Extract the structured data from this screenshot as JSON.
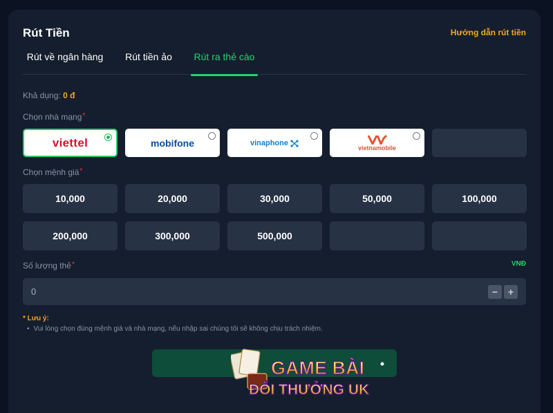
{
  "header": {
    "title": "Rút Tiền",
    "guide_link": "Hướng dẫn rút tiền"
  },
  "tabs": [
    {
      "label": "Rút về ngân hàng",
      "active": false
    },
    {
      "label": "Rút tiền ảo",
      "active": false
    },
    {
      "label": "Rút ra thẻ cào",
      "active": true
    }
  ],
  "balance": {
    "label": "Khả dụng:",
    "amount": "0 đ"
  },
  "carrier_section": {
    "label": "Chọn nhà mạng",
    "required_mark": "*",
    "carriers": [
      {
        "name": "viettel",
        "selected": true
      },
      {
        "name": "mobifone",
        "selected": false
      },
      {
        "name": "vinaphone",
        "selected": false
      },
      {
        "name": "vietnamobile",
        "selected": false
      }
    ]
  },
  "denomination_section": {
    "label": "Chọn mệnh giá",
    "required_mark": "*",
    "values": [
      "10,000",
      "20,000",
      "30,000",
      "50,000",
      "100,000",
      "200,000",
      "300,000",
      "500,000"
    ]
  },
  "quantity_section": {
    "label": "Số lượng thẻ",
    "required_mark": "*",
    "currency": "VNĐ",
    "value": "0",
    "minus": "−",
    "plus": "+"
  },
  "notes": {
    "title": "* Lưu ý:",
    "items": [
      "Vui lòng chọn đúng mệnh giá và nhà mạng, nếu nhập sai chúng tôi sẽ không chịu trách nhiệm."
    ]
  },
  "watermark": {
    "line1": "GAME BÀI",
    "line2": "ĐỔI THƯỞNG UK"
  },
  "colors": {
    "accent_green": "#23d36c",
    "accent_orange": "#f3a521",
    "required_red": "#ff3b3b",
    "panel": "#151e2e",
    "card_dark": "#283245"
  }
}
